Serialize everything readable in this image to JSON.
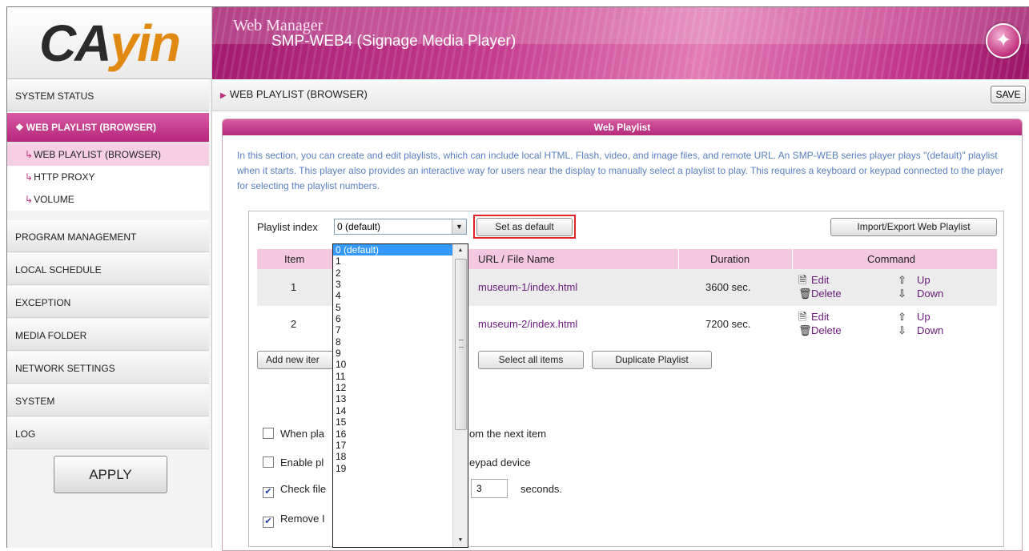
{
  "header": {
    "logo_text_a": "CA",
    "logo_text_b": "yin",
    "title": "Web Manager",
    "subtitle": "SMP-WEB4 (Signage Media Player)",
    "brand_color": "#b32a7a"
  },
  "sidebar": {
    "items": [
      {
        "label": "SYSTEM STATUS"
      },
      {
        "label": "WEB PLAYLIST (BROWSER)"
      },
      {
        "label": "PROGRAM MANAGEMENT"
      },
      {
        "label": "LOCAL SCHEDULE"
      },
      {
        "label": "EXCEPTION"
      },
      {
        "label": "MEDIA FOLDER"
      },
      {
        "label": "NETWORK SETTINGS"
      },
      {
        "label": "SYSTEM"
      },
      {
        "label": "LOG"
      }
    ],
    "subitems": [
      {
        "label": "WEB PLAYLIST (BROWSER)"
      },
      {
        "label": "HTTP PROXY"
      },
      {
        "label": "VOLUME"
      }
    ],
    "apply_label": "APPLY"
  },
  "crumb": {
    "text": "WEB PLAYLIST (BROWSER)",
    "save_label": "SAVE"
  },
  "panel": {
    "title": "Web Playlist",
    "intro": "In this section, you can create and edit playlists, which can include local HTML, Flash, video, and image files, and remote URL. An SMP-WEB series player plays \"(default)\" playlist when it starts. This player also provides an interactive way for users near the display to manually select a playlist to play. This requires a keyboard or keypad connected to the player for selecting the playlist numbers.",
    "playlist_index_label": "Playlist index",
    "playlist_index_value": "0 (default)",
    "set_default_label": "Set as default",
    "import_export_label": "Import/Export Web Playlist",
    "table": {
      "headers": [
        "Item",
        "URL / File Name",
        "Duration",
        "Command"
      ],
      "rows": [
        {
          "item": "1",
          "url": "museum-1/index.html",
          "duration": "3600 sec."
        },
        {
          "item": "2",
          "url": "museum-2/index.html",
          "duration": "7200 sec."
        }
      ],
      "cmd_edit": "Edit",
      "cmd_delete": "Delete",
      "cmd_up": "Up",
      "cmd_down": "Down"
    },
    "add_new_label": "Add new iter",
    "select_all_label": "Select all items",
    "duplicate_label": "Duplicate Playlist",
    "options": [
      {
        "left": "When pla",
        "right": "om the next item",
        "checked": false
      },
      {
        "left": "Enable pl",
        "right": "eypad device",
        "checked": false
      },
      {
        "left": "Check file",
        "right": "seconds.",
        "checked": true
      },
      {
        "left": "Remove I",
        "right": "",
        "checked": true
      }
    ],
    "seconds_value": "3"
  },
  "dropdown": {
    "options": [
      "0 (default)",
      "1",
      "2",
      "3",
      "4",
      "5",
      "6",
      "7",
      "8",
      "9",
      "10",
      "11",
      "12",
      "13",
      "14",
      "15",
      "16",
      "17",
      "18",
      "19"
    ],
    "highlighted": "0 (default)"
  }
}
